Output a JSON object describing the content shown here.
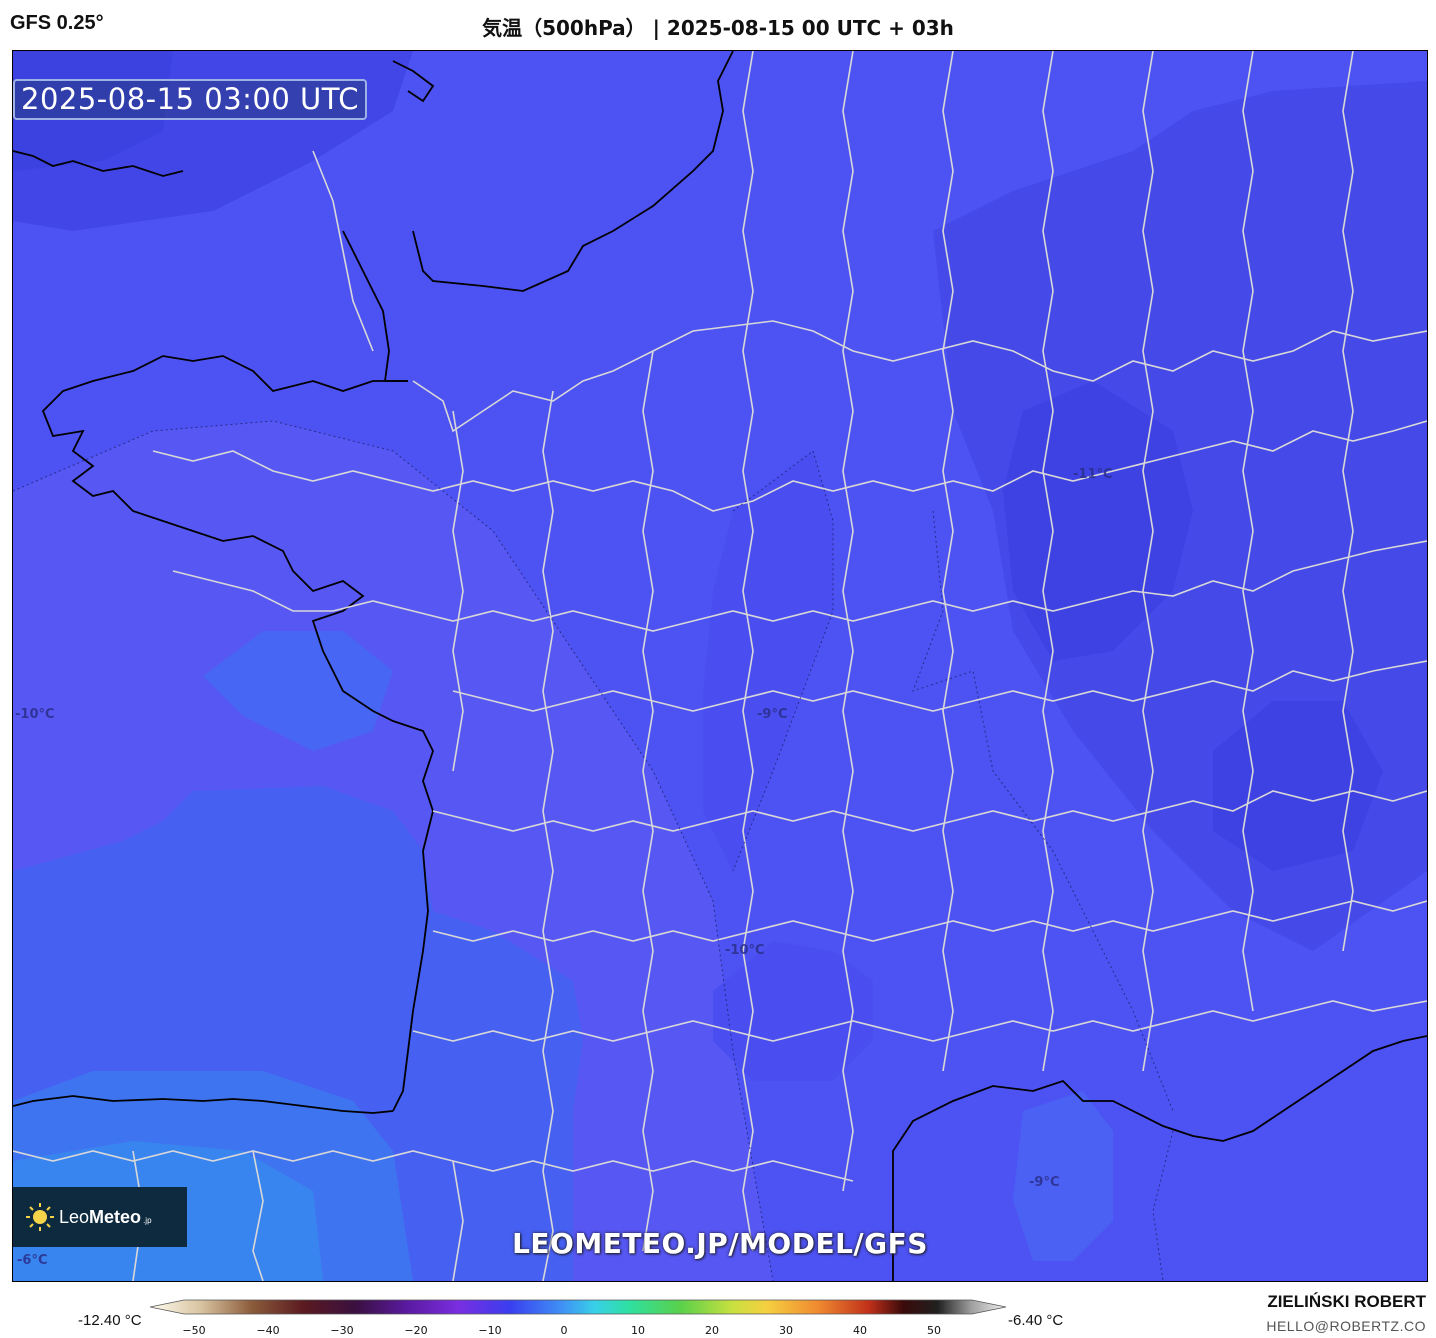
{
  "header": {
    "model": "GFS 0.25°",
    "title": "気温（500hPa） | 2025-08-15 00 UTC + 03h"
  },
  "map": {
    "timestamp": "2025-08-15 03:00 UTC",
    "watermark": "LEOMETEO.JP/MODEL/GFS",
    "logo": {
      "leo": "Leo",
      "meteo": "Meteo",
      "suffix": ".jp"
    },
    "isotherm_labels": [
      "-11°C",
      "-10°C",
      "-9°C",
      "-10°C",
      "-9°C",
      "-6°C"
    ],
    "colors": {
      "background_field": "#4d52f2",
      "coast": "#000000",
      "borders": "#d8d8d8"
    }
  },
  "colorbar": {
    "min_label": "-12.40 °C",
    "max_label": "-6.40 °C",
    "ticks": [
      "−50",
      "−40",
      "−30",
      "−20",
      "−10",
      "0",
      "10",
      "20",
      "30",
      "40",
      "50"
    ]
  },
  "author": {
    "name": "ZIELIŃSKI ROBERT",
    "email": "HELLO@ROBERTZ.CO"
  }
}
